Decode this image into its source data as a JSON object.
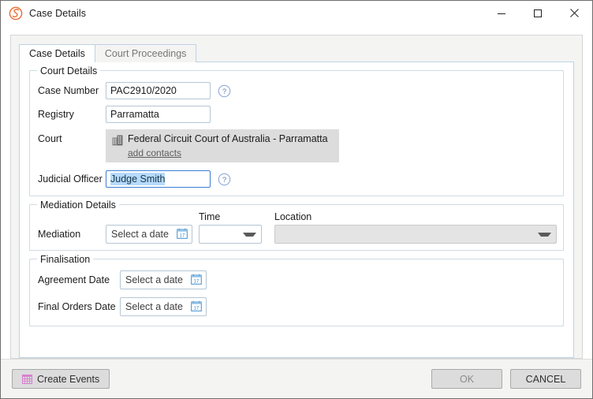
{
  "window": {
    "title": "Case Details",
    "logo_icon": "orange-swirl-logo",
    "controls": {
      "minimize": "minimize-icon",
      "maximize": "maximize-icon",
      "close": "close-icon"
    }
  },
  "tabs": [
    {
      "label": "Case Details",
      "active": true
    },
    {
      "label": "Court Proceedings",
      "active": false
    }
  ],
  "court_details": {
    "legend": "Court Details",
    "case_number": {
      "label": "Case Number",
      "value": "PAC2910/2020",
      "placeholder": "",
      "help_icon": "question-mark-icon"
    },
    "registry": {
      "label": "Registry",
      "value": "Parramatta",
      "placeholder": ""
    },
    "court": {
      "label": "Court",
      "icon": "building-icon",
      "name": "Federal Circuit Court of Australia - Parramatta",
      "add_contacts_link": "add contacts"
    },
    "judicial_officer": {
      "label": "Judicial Officer",
      "value": "Judge Smith",
      "placeholder": "",
      "selected": true,
      "focused": true,
      "help_icon": "question-mark-icon"
    }
  },
  "mediation_details": {
    "legend": "Mediation Details",
    "row_label": "Mediation",
    "date": {
      "value": "Select a date",
      "icon": "calendar-icon"
    },
    "time": {
      "header": "Time",
      "value": "",
      "icon": "chevron-down-icon"
    },
    "location": {
      "header": "Location",
      "value": "",
      "icon": "chevron-down-icon",
      "disabled": true
    }
  },
  "finalisation": {
    "legend": "Finalisation",
    "agreement_date": {
      "label": "Agreement Date",
      "value": "Select a date",
      "icon": "calendar-icon"
    },
    "final_orders_date": {
      "label": "Final Orders Date",
      "value": "Select a date",
      "icon": "calendar-icon"
    }
  },
  "footer": {
    "create_events": {
      "label": "Create Events",
      "icon": "calendar-grid-icon"
    },
    "ok": "OK",
    "cancel": "CANCEL"
  },
  "colors": {
    "brand_orange": "#e8733c",
    "help_blue": "#8fa8d8",
    "calendar_blue": "#3f8fd0",
    "create_events_pink": "#d97fd0",
    "selection_blue": "#b5dafb",
    "focus_blue": "#3a7fd5",
    "panel_bg": "#f4f4f3",
    "readonly_gray": "#dcdcdc"
  }
}
